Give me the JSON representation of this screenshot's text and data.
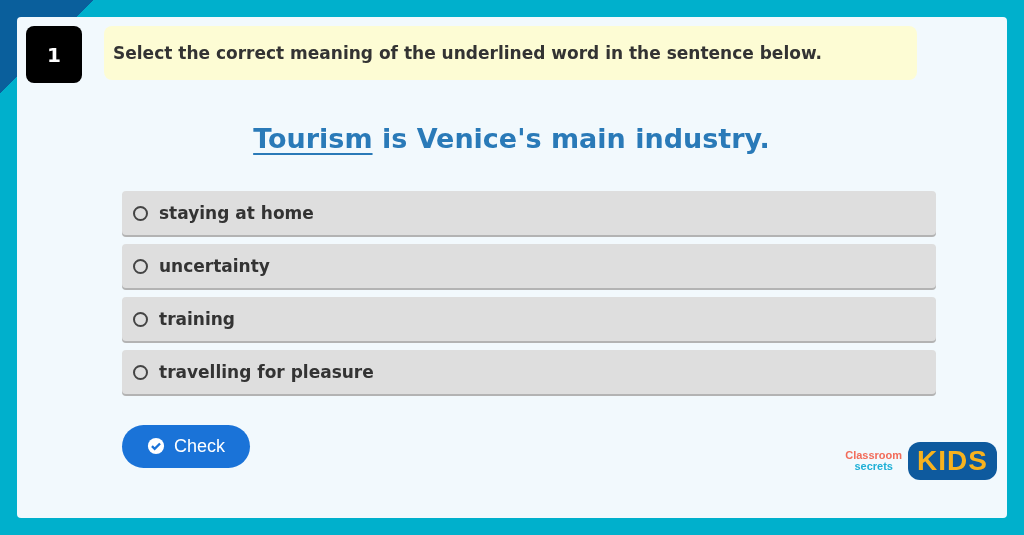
{
  "question_number": "1",
  "instruction": "Select the correct meaning of the underlined word in the sentence below.",
  "sentence": {
    "underlined": "Tourism",
    "rest": " is Venice's main industry."
  },
  "options": [
    {
      "label": "staying at home",
      "selected": false
    },
    {
      "label": "uncertainty",
      "selected": false
    },
    {
      "label": "training",
      "selected": false
    },
    {
      "label": "travelling for pleasure",
      "selected": false
    }
  ],
  "check_button": "Check",
  "logo": {
    "line_1": "Classroom",
    "line_2": "secrets",
    "badge": "KIDS"
  }
}
